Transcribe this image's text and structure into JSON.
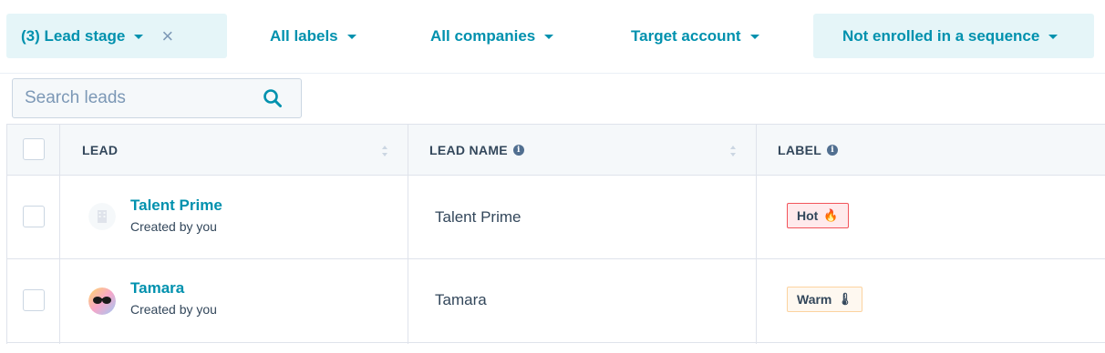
{
  "filters": {
    "lead_stage": "(3) Lead stage",
    "labels": "All labels",
    "companies": "All companies",
    "target_account": "Target account",
    "sequence": "Not enrolled in a sequence"
  },
  "search": {
    "placeholder": "Search leads",
    "value": ""
  },
  "table": {
    "headers": {
      "lead": "LEAD",
      "lead_name": "LEAD NAME",
      "label": "LABEL"
    },
    "rows": [
      {
        "lead": "Talent Prime",
        "sub": "Created by you",
        "lead_name": "Talent Prime",
        "label": "Hot",
        "emoji": "🔥",
        "avatar": "building-avatar-icon"
      },
      {
        "lead": "Tamara",
        "sub": "Created by you",
        "lead_name": "Tamara",
        "label": "Warm",
        "emoji": "🌡",
        "avatar": "person-avatar"
      }
    ]
  },
  "colors": {
    "accent": "#0091ae",
    "hot_border": "#f2545b",
    "warm_border": "#fcd39f"
  }
}
